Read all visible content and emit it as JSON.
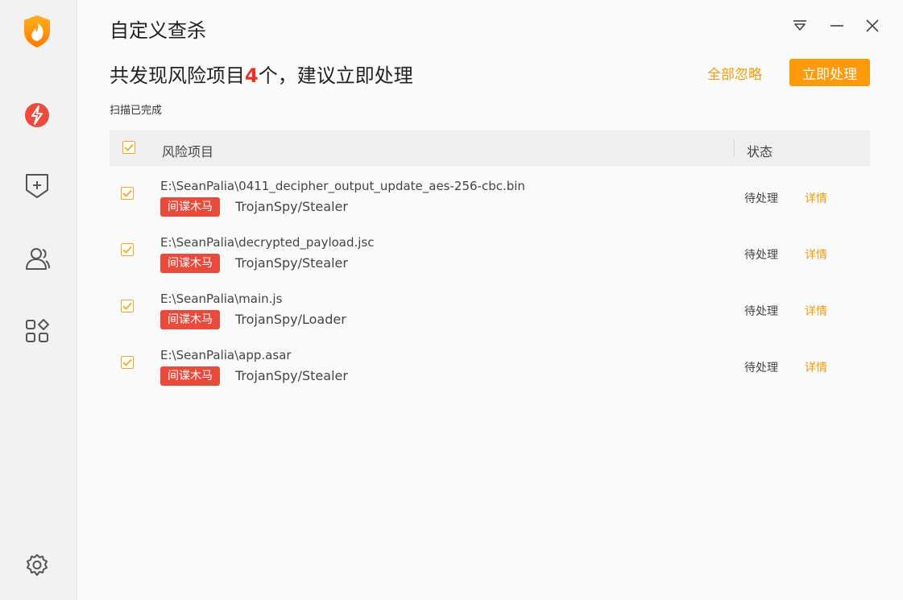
{
  "window": {
    "title": "自定义查杀"
  },
  "summary": {
    "prefix": "共发现风险项目",
    "count": "4",
    "suffix": "个，建议立即处理",
    "scan_status": "扫描已完成"
  },
  "actions": {
    "ignore_all": "全部忽略",
    "handle_now": "立即处理"
  },
  "table": {
    "columns": [
      "风险项目",
      "状态"
    ],
    "rows": [
      {
        "path": "E:\\SeanPalia\\0411_decipher_output_update_aes-256-cbc.bin",
        "badge": "间谍木马",
        "threat": "TrojanSpy/Stealer",
        "status": "待处理",
        "detail": "详情"
      },
      {
        "path": "E:\\SeanPalia\\decrypted_payload.jsc",
        "badge": "间谍木马",
        "threat": "TrojanSpy/Stealer",
        "status": "待处理",
        "detail": "详情"
      },
      {
        "path": "E:\\SeanPalia\\main.js",
        "badge": "间谍木马",
        "threat": "TrojanSpy/Loader",
        "status": "待处理",
        "detail": "详情"
      },
      {
        "path": "E:\\SeanPalia\\app.asar",
        "badge": "间谍木马",
        "threat": "TrojanSpy/Stealer",
        "status": "待处理",
        "detail": "详情"
      }
    ]
  },
  "icons": {
    "sidebar": [
      "flame-shield-logo-icon",
      "lightning-icon",
      "shield-plus-icon",
      "users-icon",
      "apps-grid-icon",
      "gear-icon"
    ],
    "window_controls": [
      "menu-icon",
      "minimize-icon",
      "close-icon"
    ]
  },
  "colors": {
    "accent": "#fd9a0c",
    "danger": "#e84b3c",
    "count": "#e8321e"
  }
}
